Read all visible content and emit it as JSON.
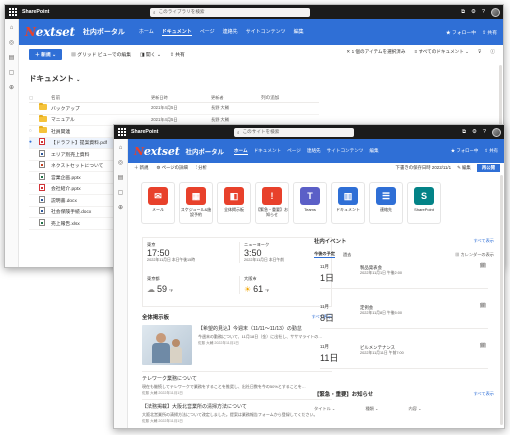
{
  "brand": {
    "blue": "#2f6fd6",
    "dark": "#1b1b1b",
    "accent_red": "#e8412b"
  },
  "suite": {
    "app_name": "SharePoint",
    "back_search": "このライブラリを検索",
    "front_search": "このサイトを検索"
  },
  "site": {
    "logo_prefix": "N",
    "logo_rest": "extset",
    "title": "社内ポータル",
    "nav_back": [
      "ホーム",
      "ドキュメント",
      "ページ",
      "連絡先",
      "サイトコンテンツ",
      "編集"
    ],
    "nav_front": [
      "ホーム",
      "ドキュメント",
      "ページ",
      "連絡先",
      "サイトコンテンツ",
      "編集"
    ],
    "follow": "★ フォロー中",
    "share": "共有"
  },
  "library": {
    "new_button": "＋ 新規 ⌄",
    "grid_edit": "グリッド ビューでの編集",
    "open": "開く ⌄",
    "share": "共有",
    "selected": "1 個のアイテムを選択済み",
    "all_docs": "すべてのドキュメント",
    "title": "ドキュメント",
    "columns": [
      "名前",
      "更新日時",
      "更新者",
      "列の追加"
    ],
    "rows": [
      {
        "type": "folder",
        "name": "バックアップ",
        "date": "2021年4月5日",
        "by": "長野 大輔"
      },
      {
        "type": "folder",
        "name": "マニュアル",
        "date": "2021年4月5日",
        "by": "長野 大輔"
      },
      {
        "type": "folder",
        "name": "社員関連",
        "date": "2021年4月5日",
        "by": "長野 大輔"
      },
      {
        "type": "pdf",
        "name": "【ドラフト】提案資料.pdf",
        "date": "",
        "by": ""
      },
      {
        "type": "doc",
        "name": "エリア別売上資料",
        "date": "",
        "by": ""
      },
      {
        "type": "ppt",
        "name": "ネクストセットについて",
        "date": "",
        "by": ""
      },
      {
        "type": "xls",
        "name": "営業企画.pptx",
        "date": "",
        "by": ""
      },
      {
        "type": "pdf",
        "name": "会社紹介.pptx",
        "date": "",
        "by": ""
      },
      {
        "type": "doc",
        "name": "説明書.docx",
        "date": "",
        "by": ""
      },
      {
        "type": "doc",
        "name": "社会保険手続.docx",
        "date": "",
        "by": ""
      },
      {
        "type": "xls",
        "name": "売上報告.xlsx",
        "date": "",
        "by": ""
      }
    ]
  },
  "page": {
    "new": "＋ 新規",
    "details": "ページの詳細",
    "analytics": "分析",
    "draft": "下書きの保存日時 2022/11/1",
    "edit": "編集",
    "republish": "再公開"
  },
  "apps": [
    {
      "label": "メール",
      "icon": "mail-icon",
      "color": "#e8412b",
      "glyph": "✉"
    },
    {
      "label": "スケジュール&施設予約",
      "icon": "calendar-icon",
      "color": "#e8412b",
      "glyph": "▦"
    },
    {
      "label": "全体掲示板",
      "icon": "board-icon",
      "color": "#e8412b",
      "glyph": "◧"
    },
    {
      "label": "【緊急・重要】お知らせ",
      "icon": "alert-icon",
      "color": "#e8412b",
      "glyph": "!"
    },
    {
      "label": "Teams",
      "icon": "teams-icon",
      "color": "#5b5fc7",
      "glyph": "T"
    },
    {
      "label": "ドキュメント",
      "icon": "folder-binders-icon",
      "color": "#2f6fd6",
      "glyph": "▥"
    },
    {
      "label": "連絡先",
      "icon": "contacts-icon",
      "color": "#2f6fd6",
      "glyph": "☰"
    },
    {
      "label": "SharePoint",
      "icon": "sharepoint-icon",
      "color": "#038387",
      "glyph": "S"
    }
  ],
  "world_clock": [
    {
      "city": "東京",
      "time": "17:50",
      "date": "2022年11月日  本日午後15時"
    },
    {
      "city": "ニューヨーク",
      "time": "3:50",
      "date": "2022年11月日  本日午前"
    }
  ],
  "weather": [
    {
      "city": "東京都",
      "temp": "59",
      "unit": "°F"
    },
    {
      "city": "大阪市",
      "temp": "61",
      "unit": "°F"
    }
  ],
  "events": {
    "title": "社内イベント",
    "see_all": "すべて表示",
    "tab_upcoming": "今後の予定",
    "tab_past": "過去",
    "calendar_link": "カレンダーの表示",
    "items": [
      {
        "month": "11月",
        "day": "1日",
        "title": "製品発表会",
        "time": "2022年11月1日 午後2:00"
      },
      {
        "month": "11月",
        "day": "8日",
        "title": "定例会",
        "time": "2022年11月8日 午後5:00"
      },
      {
        "month": "11月",
        "day": "11日",
        "title": "ビルメンテナンス",
        "time": "2022年11月11日 午前7:00"
      }
    ]
  },
  "board": {
    "title": "全体掲示板",
    "see_all": "すべて表示",
    "items": [
      {
        "title": "【希望的見込】今週末（11/11〜11/13）の勤怠",
        "body": "今週末の勤務について、11月18日（金）に出社し、ササマライトの…",
        "meta": "佐藤 大輔  2022年11月1日"
      },
      {
        "title": "テレワーク業務について",
        "body": "現在も継続してテレワークで業務をすることを推奨し、出社日数を今の50%とすることを…",
        "meta": "佐藤 大輔  2022年11月1日"
      },
      {
        "title": "【法務掲載】大阪北営業所の清掃方法について",
        "body": "大阪北営業所の清掃方法について改定しました。提案は業務報告フォームから登録してください。",
        "meta": "佐藤 大輔  2022年11月1日"
      }
    ]
  },
  "notices": {
    "title": "【緊急・重要】お知らせ",
    "see_all": "すべて表示",
    "columns": [
      "タイトル",
      "種類",
      "内容"
    ]
  }
}
